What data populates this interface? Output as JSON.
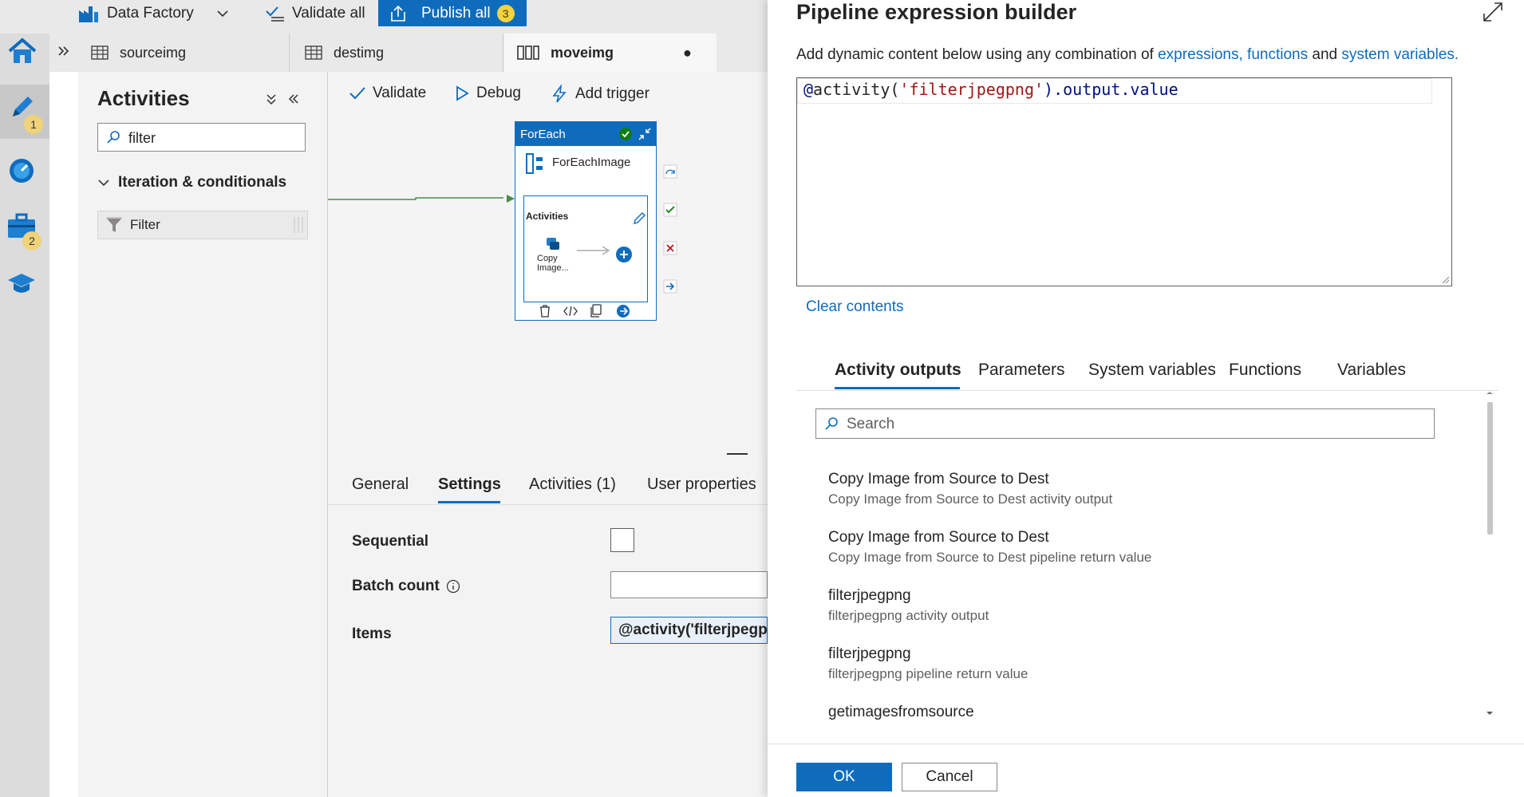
{
  "topbar": {
    "factory_label": "Data Factory",
    "validate_all_label": "Validate all",
    "publish_all_label": "Publish all",
    "publish_count": "3"
  },
  "rail": {
    "author_badge": "1",
    "manage_badge": "2"
  },
  "tabs": [
    {
      "label": "sourceimg"
    },
    {
      "label": "destimg"
    },
    {
      "label": "moveimg",
      "unsaved": "●"
    }
  ],
  "activities": {
    "title": "Activities",
    "search_value": "filter",
    "group_label": "Iteration & conditionals",
    "item_label": "Filter"
  },
  "canvas": {
    "validate_label": "Validate",
    "debug_label": "Debug",
    "add_trigger_label": "Add trigger",
    "foreach_header": "ForEach",
    "foreach_name": "ForEachImage",
    "inner_activities_label": "Activities",
    "copy_label_1": "Copy",
    "copy_label_2": "Image..."
  },
  "settings": {
    "tabs": [
      "General",
      "Settings",
      "Activities (1)",
      "User properties"
    ],
    "sequential_label": "Sequential",
    "batch_count_label": "Batch count",
    "items_label": "Items",
    "items_value": "@activity('filterjpegpr"
  },
  "builder": {
    "title": "Pipeline expression builder",
    "desc_prefix": "Add dynamic content below using any combination of ",
    "desc_link1": "expressions, functions",
    "desc_and": " and ",
    "desc_link2": "system variables.",
    "expr_at": "@",
    "expr_fn": "activity(",
    "expr_str": "'filterjpegpng'",
    "expr_rest": ").output.value",
    "clear_label": "Clear contents",
    "tabs": [
      "Activity outputs",
      "Parameters",
      "System variables",
      "Functions",
      "Variables"
    ],
    "search_placeholder": "Search",
    "results": [
      {
        "title": "Copy Image from Source to Dest",
        "sub": "Copy Image from Source to Dest activity output"
      },
      {
        "title": "Copy Image from Source to Dest",
        "sub": "Copy Image from Source to Dest pipeline return value"
      },
      {
        "title": "filterjpegpng",
        "sub": "filterjpegpng activity output"
      },
      {
        "title": "filterjpegpng",
        "sub": "filterjpegpng pipeline return value"
      },
      {
        "title": "getimagesfromsource",
        "sub": ""
      }
    ],
    "ok_label": "OK",
    "cancel_label": "Cancel"
  },
  "colors": {
    "accent": "#0f6cbd",
    "badge": "#f5d33e",
    "string": "#a31515",
    "keyword": "#001080",
    "success": "#0e8a16",
    "error": "#c50f1f"
  }
}
